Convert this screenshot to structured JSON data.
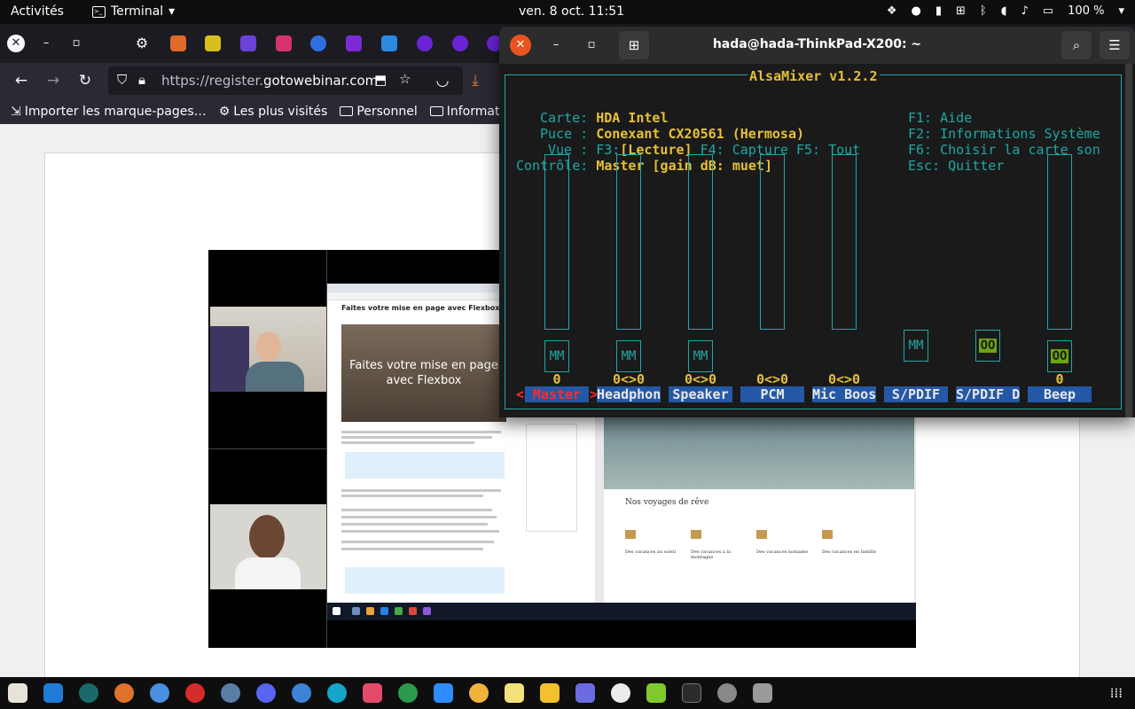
{
  "topbar": {
    "activities": "Activités",
    "app_menu": "Terminal",
    "clock": "ven. 8 oct.  11:51",
    "battery": "100 %"
  },
  "firefox": {
    "url_prefix": "https://register.",
    "url_domain": "gotowebinar.com",
    "bookmarks": [
      "Importer les marque-pages…",
      "Les plus visités",
      "Personnel",
      "Informatique"
    ]
  },
  "webinar": {
    "page_heading": "Faites votre mise en page avec Flexbox",
    "video_title": "Faites votre mise en page avec Flexbox",
    "site_section": "Nos voyages de rêve",
    "cards": [
      "Des vacances au soleil",
      "Des vacances à la montagne",
      "Des vacances nomades",
      "Des vacances en famille"
    ]
  },
  "terminal": {
    "title": "hada@hada-ThinkPad-X200: ~"
  },
  "alsamixer": {
    "title": "AlsaMixer v1.2.2",
    "card_label": "Carte:",
    "card_value": "HDA Intel",
    "chip_label": "Puce :",
    "chip_value": "Conexant CX20561 (Hermosa)",
    "view_label": "Vue :",
    "view_f3": "F3:",
    "view_current": "[Lecture]",
    "view_f4": "F4:",
    "view_f4_text": "Capture",
    "view_f5": "F5:",
    "view_f5_text": "Tout",
    "control_label": "Contrôle:",
    "control_value": "Master [gain dB: muet]",
    "help": [
      {
        "key": "F1:",
        "text": "Aide"
      },
      {
        "key": "F2:",
        "text": "Informations Système"
      },
      {
        "key": "F6:",
        "text": "Choisir la carte son"
      },
      {
        "key": "Esc:",
        "text": "Quitter"
      }
    ],
    "channels": [
      {
        "name": "Master",
        "db": "0",
        "switch": "MM",
        "muted": true,
        "level": 0
      },
      {
        "name": "Headphon",
        "db": "0<>0",
        "switch": "MM",
        "muted": true,
        "level": 0
      },
      {
        "name": "Speaker",
        "db": "0<>0",
        "switch": "MM",
        "muted": true,
        "level": 0
      },
      {
        "name": "PCM",
        "db": "0<>0",
        "switch": "",
        "muted": false,
        "level": 0
      },
      {
        "name": "Mic Boos",
        "db": "0<>0",
        "switch": "",
        "muted": false,
        "level": 0
      },
      {
        "name": "S/PDIF",
        "db": "",
        "switch": "MM",
        "muted": true,
        "level": 0
      },
      {
        "name": "S/PDIF D",
        "db": "",
        "switch": "OO",
        "muted": false,
        "level": 0
      },
      {
        "name": "Beep",
        "db": "0",
        "switch": "OO",
        "muted": false,
        "level": 0
      }
    ],
    "colors": {
      "frame": "#22a6a6",
      "value": "#e5c03a",
      "channel_bg": "#2458a7",
      "selected": "#ff2b2b",
      "switch_on": "#6aa512"
    }
  }
}
